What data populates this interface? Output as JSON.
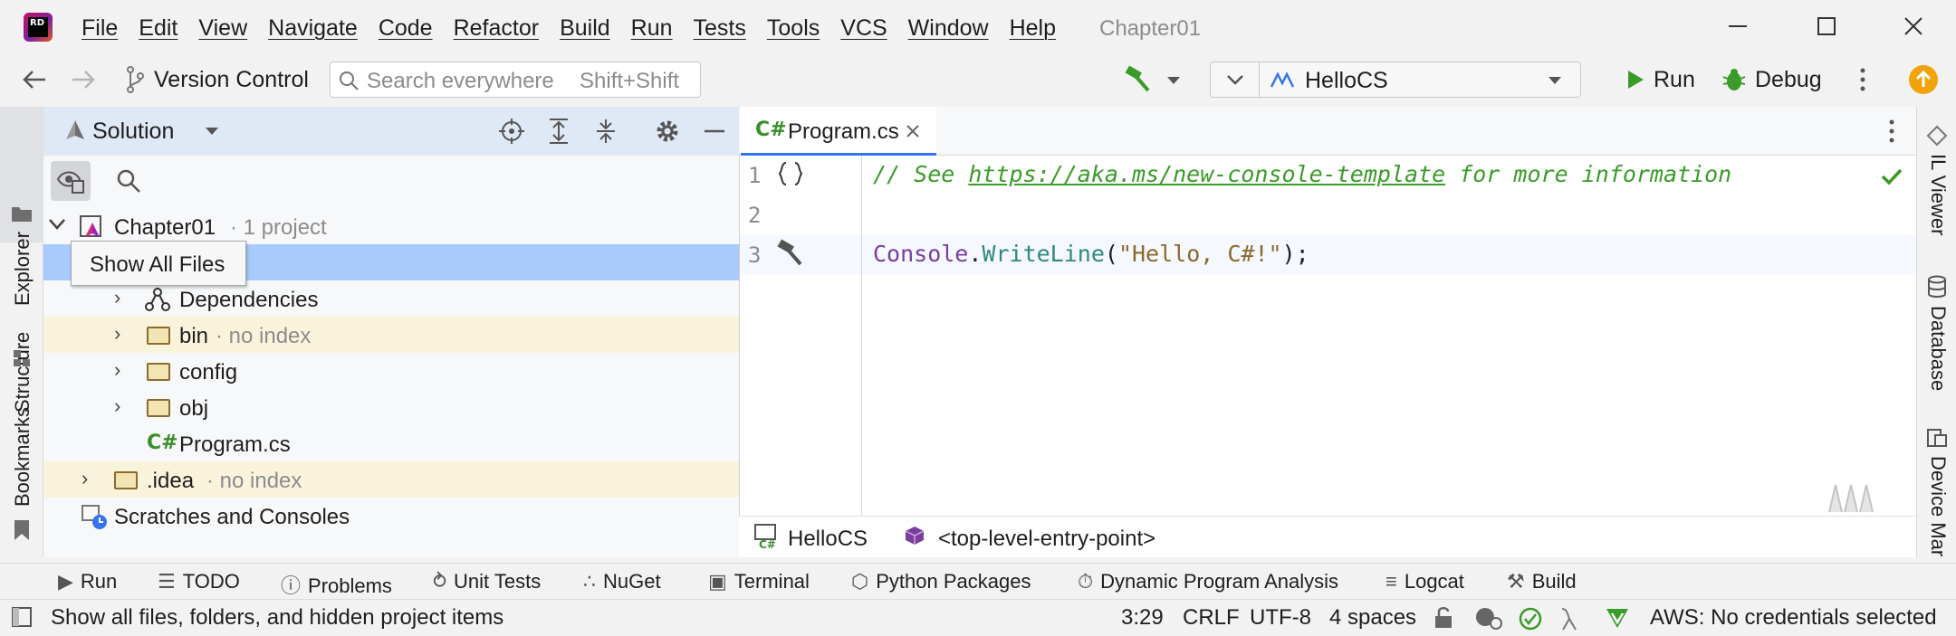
{
  "app": {
    "logo_text": "RD",
    "project_title": "Chapter01"
  },
  "menu": [
    "File",
    "Edit",
    "View",
    "Navigate",
    "Code",
    "Refactor",
    "Build",
    "Run",
    "Tests",
    "Tools",
    "VCS",
    "Window",
    "Help"
  ],
  "toolbar": {
    "vcs_label": "Version Control",
    "search_placeholder": "Search everywhere",
    "search_shortcut": "Shift+Shift",
    "run_config": "HelloCS",
    "run_label": "Run",
    "debug_label": "Debug"
  },
  "left_strip": [
    "Explorer",
    "Structure",
    "Bookmarks"
  ],
  "right_strip": [
    "IL Viewer",
    "Database",
    "Device Mar"
  ],
  "panel": {
    "title": "Solution",
    "tooltip": "Show All Files"
  },
  "tree": {
    "root": "Chapter01",
    "root_suffix": "· 1 project",
    "dependencies": "Dependencies",
    "bin": "bin",
    "bin_suffix": "· no index",
    "config": "config",
    "obj": "obj",
    "program": "Program.cs",
    "idea": ".idea",
    "idea_suffix": "· no index",
    "scratches": "Scratches and Consoles",
    "cs_badge": "C#"
  },
  "editor": {
    "tab_badge": "C#",
    "tab": "Program.cs",
    "line_numbers": [
      "1",
      "2",
      "3"
    ],
    "line1_prefix": "// See ",
    "line1_link": "https://aka.ms/new-console-template",
    "line1_suffix": " for more information",
    "line3_class": "Console",
    "line3_dot": ".",
    "line3_method": "WriteLine",
    "line3_open": "(",
    "line3_string": "\"Hello, C#!\"",
    "line3_close": ");",
    "breadcrumb_project": "HelloCS",
    "breadcrumb_member": "<top-level-entry-point>"
  },
  "bottom_tools": [
    "Run",
    "TODO",
    "Problems",
    "Unit Tests",
    "NuGet",
    "Terminal",
    "Python Packages",
    "Dynamic Program Analysis",
    "Logcat",
    "Build"
  ],
  "status": {
    "message": "Show all files, folders, and hidden project items",
    "position": "3:29",
    "line_ending": "CRLF",
    "encoding": "UTF-8",
    "indent": "4 spaces",
    "aws": "AWS: No credentials selected"
  },
  "colors": {
    "accent": "#3574f0",
    "selection": "#a9cbfb",
    "comment": "#3a9b28",
    "keyword_class": "#7a3e9d",
    "method": "#2e8a7a",
    "string": "#8a6a2a",
    "run_green": "#3a9b28"
  }
}
